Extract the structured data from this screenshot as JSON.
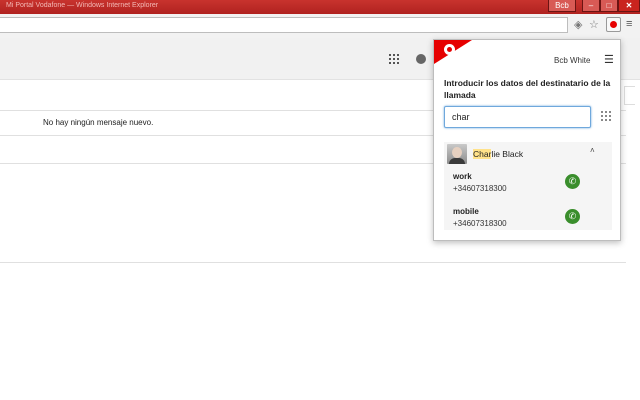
{
  "window": {
    "title": "Mi Portal Vodafone — Windows Internet Explorer",
    "user_badge": "Bcb",
    "minimize": "–",
    "maximize": "□",
    "close": "✕"
  },
  "toolbar": {
    "icons": [
      "flash-icon",
      "star-icon",
      "vodafone-extension-icon",
      "menu-icon"
    ],
    "flash_glyph": "◈",
    "star_glyph": "☆",
    "menu_glyph": "≡"
  },
  "inbox": {
    "empty_message": "No hay ningún mensaje nuevo."
  },
  "popup": {
    "user_name": "Bcb White",
    "menu_glyph": "☰",
    "heading": "Introducir los datos del destinatario de la llamada",
    "search_value": "char",
    "contact": {
      "name_match": "Char",
      "name_rest": "lie Black",
      "collapse_glyph": "˄",
      "phones": [
        {
          "type": "work",
          "number": "+34607318300"
        },
        {
          "type": "mobile",
          "number": "+34607318300"
        }
      ],
      "call_glyph": "✆"
    }
  },
  "colors": {
    "brand": "#e60000",
    "titlebar": "#c8332e",
    "call_green": "#3a8e2c",
    "highlight": "#ffe28a"
  }
}
